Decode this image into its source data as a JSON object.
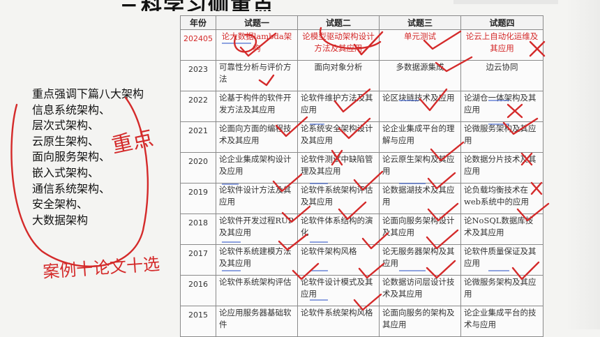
{
  "title": "三科学习侧重点",
  "left_note": {
    "heading": "重点强调下篇八大架构",
    "items": [
      "信息系统架构、",
      "层次式架构、",
      "云原生架构、",
      "面向服务架构、",
      "嵌入式架构、",
      "通信系统架构、",
      "安全架构、",
      "大数据架构"
    ]
  },
  "handwriting": {
    "circle_label": "重点",
    "bottom_label": "案例十论文十选"
  },
  "table": {
    "headers": [
      "年份",
      "试题一",
      "试题二",
      "试题三",
      "试题四"
    ],
    "rows": [
      {
        "year": "202405",
        "cells": [
          "论大数据lambda架构",
          "论模型驱动架构设计方法及其应用",
          "单元测试",
          "论云上自动化运维及其应用"
        ]
      },
      {
        "year": "2023",
        "cells": [
          "可靠性分析与评价方法",
          "面向对象分析",
          "多数据源集成",
          "边云协同"
        ]
      },
      {
        "year": "2022",
        "cells": [
          "论基于构件的软件开发方法及其应用",
          "论软件维护方法及其应用",
          "论区块链技术及应用",
          "论湖仓一体架构及其应用"
        ]
      },
      {
        "year": "2021",
        "cells": [
          "论面向方面的编程技术及其应用",
          "论系统安全架构设计及其应用",
          "论企业集成平台的理解与应用",
          "论微服务架构及其应用"
        ]
      },
      {
        "year": "2020",
        "cells": [
          "论企业集成架构设计及应用",
          "论软件测试中缺陷管理及其应用",
          "论云原生架构及其应用",
          "论数据分片技术及其应用"
        ]
      },
      {
        "year": "2019",
        "cells": [
          "论软件设计方法及其应用",
          "论软件系统架构评估及其应用",
          "论数据湖技术及其应用",
          "论负载均衡技术在web系统中的应用"
        ]
      },
      {
        "year": "2018",
        "cells": [
          "论软件开发过程RUP及其应用",
          "论软件体系结构的演化",
          "论面向服务架构设计及其应用",
          "论NoSQL数据库技术及其应用"
        ]
      },
      {
        "year": "2017",
        "cells": [
          "论软件系统建模方法及其应用",
          "论软件架构风格",
          "论无服务器架构及其应用",
          "论软件质量保证及其应用"
        ]
      },
      {
        "year": "2016",
        "cells": [
          "论软件系统架构评估",
          "论软件设计模式及其应用",
          "论数据访问层设计技术及其应用",
          "论微服务架构及其应用"
        ]
      },
      {
        "year": "2015",
        "cells": [
          "论应用服务器基础软件",
          "论软件系统架构风格",
          "论面向服务的架构及其应用",
          "论企业集成平台的技术与应用"
        ]
      }
    ]
  },
  "colors": {
    "ink_red": "#d42a2a",
    "underline_blue": "#2f56c9"
  }
}
